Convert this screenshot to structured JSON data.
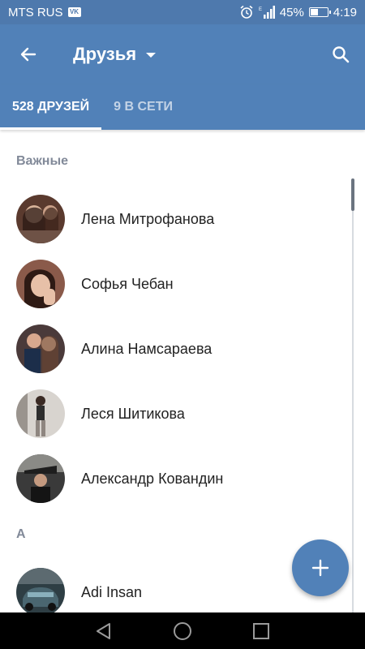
{
  "status_bar": {
    "carrier": "MTS RUS",
    "vk_badge": "VK",
    "battery_percent": "45%",
    "battery_level": 0.45,
    "time": "4:19"
  },
  "toolbar": {
    "title": "Друзья"
  },
  "tabs": [
    {
      "label": "528 ДРУЗЕЙ",
      "active": true
    },
    {
      "label": "9 В СЕТИ",
      "active": false
    }
  ],
  "sections": [
    {
      "header": "Важные",
      "friends": [
        {
          "name": "Лена Митрофанова",
          "avatar_color": "#5a3a2e"
        },
        {
          "name": "Софья Чебан",
          "avatar_color": "#8a5a4a"
        },
        {
          "name": "Алина Намсараева",
          "avatar_color": "#4a3a3a"
        },
        {
          "name": "Леся Шитикова",
          "avatar_color": "#b8b2ac"
        },
        {
          "name": "Александр Ковандин",
          "avatar_color": "#3a3a3a"
        }
      ]
    },
    {
      "header": "A",
      "friends": [
        {
          "name": "Adi Insan",
          "avatar_color": "#2e3e44"
        }
      ]
    }
  ],
  "colors": {
    "accent": "#5181b8",
    "statusbar": "#4e79ad",
    "section_header": "#828a99"
  }
}
